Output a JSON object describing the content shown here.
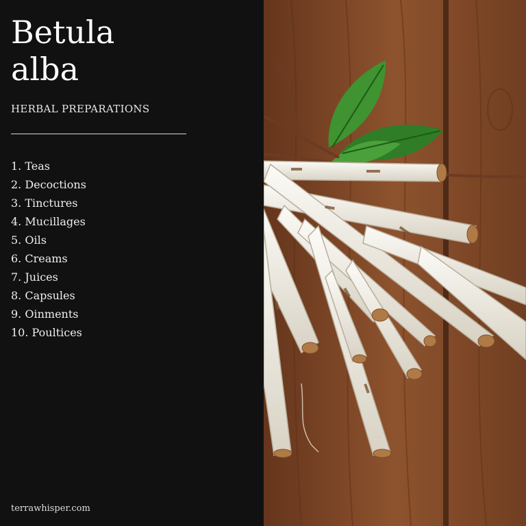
{
  "title": "Betula alba",
  "subtitle": "HERBAL PREPARATIONS",
  "preparations": [
    "1. Teas",
    "2. Decoctions",
    "3. Tinctures",
    "4. Mucillages",
    "5. Oils",
    "6. Creams",
    "7. Juices",
    "8. Capsules",
    "9. Oinments",
    "10. Poultices"
  ],
  "footer": "terrawhisper.com",
  "colors": {
    "panel": "#111111",
    "wood": "#8a4f2c",
    "bark": "#efece4",
    "leaf": "#3d8f2d"
  },
  "image": {
    "subject": "bundle of birch roots/bark sticks with green leaf on wooden planks"
  }
}
